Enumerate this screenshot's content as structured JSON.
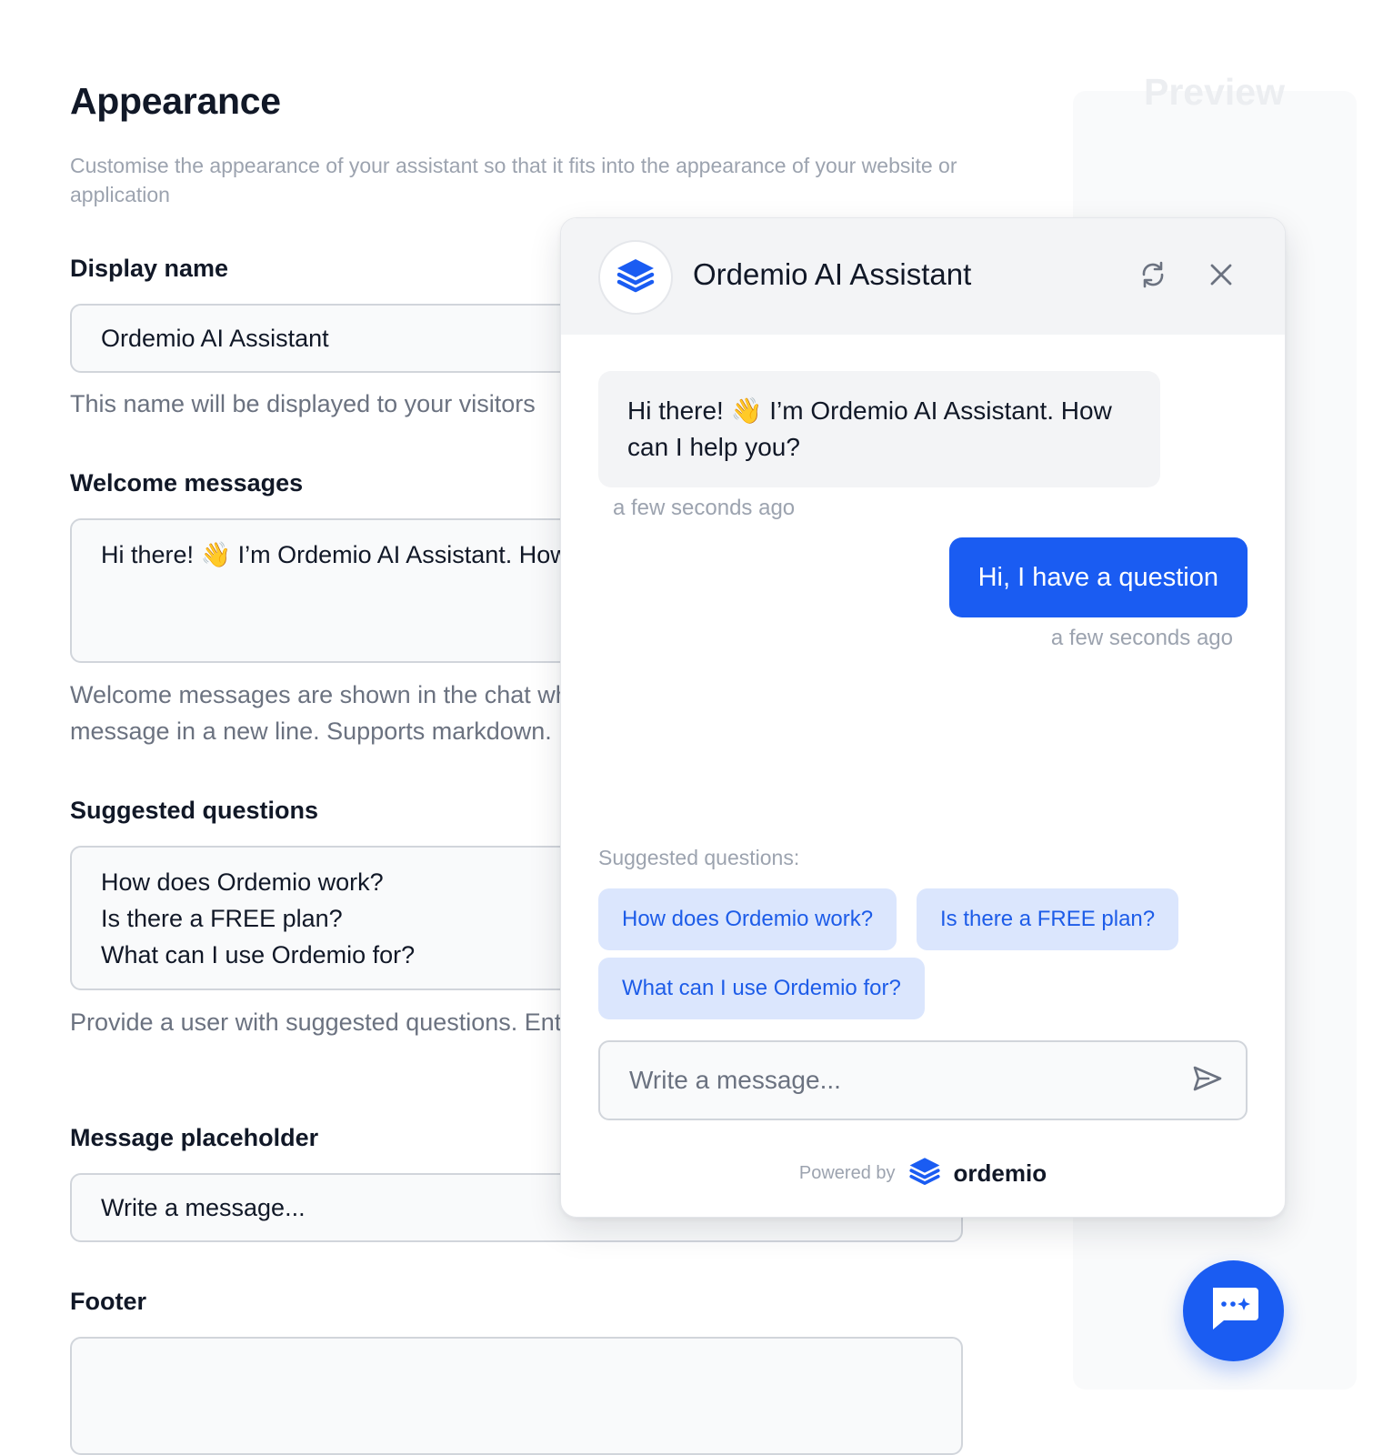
{
  "settings": {
    "title": "Appearance",
    "subtitle": "Customise the appearance of your assistant so that it fits into the appearance of your website or application",
    "display_name": {
      "label": "Display name",
      "value": "Ordemio AI Assistant",
      "help": "This name will be displayed to your visitors"
    },
    "welcome_messages": {
      "label": "Welcome messages",
      "value": "Hi there! 👋 I’m Ordemio AI Assistant. How can I help you?",
      "help": "Welcome messages are shown in the chat when it is opened. Enter each message in a new line. Supports markdown."
    },
    "suggested_questions": {
      "label": "Suggested questions",
      "lines": [
        "How does Ordemio work?",
        "Is there a FREE plan?",
        "What can I use Ordemio for?"
      ],
      "help": "Provide a user with suggested questions. Enter each question in a new line."
    },
    "message_placeholder": {
      "label": "Message placeholder",
      "value": "Write a message..."
    },
    "footer": {
      "label": "Footer",
      "value": ""
    }
  },
  "preview": {
    "title": "Preview",
    "chat": {
      "title": "Ordemio AI Assistant",
      "bot_message": "Hi there! 👋 I’m Ordemio AI Assistant. How can I help you?",
      "bot_timestamp": "a few seconds ago",
      "user_message": "Hi, I have a question",
      "user_timestamp": "a few seconds ago",
      "suggested_label": "Suggested questions:",
      "suggested_chips": [
        "How does Ordemio work?",
        "Is there a FREE plan?",
        "What can I use Ordemio for?"
      ],
      "input_placeholder": "Write a message...",
      "powered_by": "Powered by",
      "brand": "ordemio"
    }
  },
  "icons": {
    "avatar": "stacked-layers-icon",
    "refresh": "refresh-icon",
    "close": "close-icon",
    "send": "send-icon",
    "launcher": "chat-bubble-icon"
  },
  "colors": {
    "accent": "#1a5cf2",
    "chip_bg": "#dbe6fd",
    "chip_text": "#1d5ce8"
  }
}
